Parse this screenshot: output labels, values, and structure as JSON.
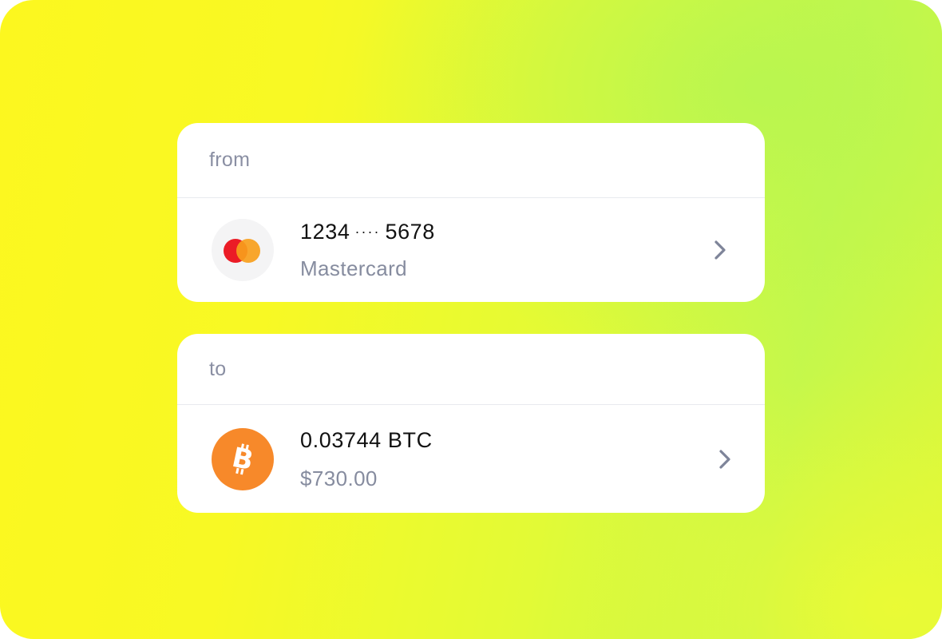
{
  "from_card": {
    "label": "from",
    "number_start": "1234",
    "number_dots": "····",
    "number_end": "5678",
    "network": "Mastercard",
    "icon": "mastercard-logo-icon"
  },
  "to_card": {
    "label": "to",
    "amount": "0.03744 BTC",
    "fiat_value": "$730.00",
    "icon": "bitcoin-icon"
  },
  "colors": {
    "background_yellow": "#fcf71f",
    "background_green": "#c5f84b",
    "mastercard_red": "#eb1c26",
    "mastercard_orange": "#f79e1b",
    "bitcoin_orange": "#f7892a",
    "secondary_text": "#868c9f"
  }
}
